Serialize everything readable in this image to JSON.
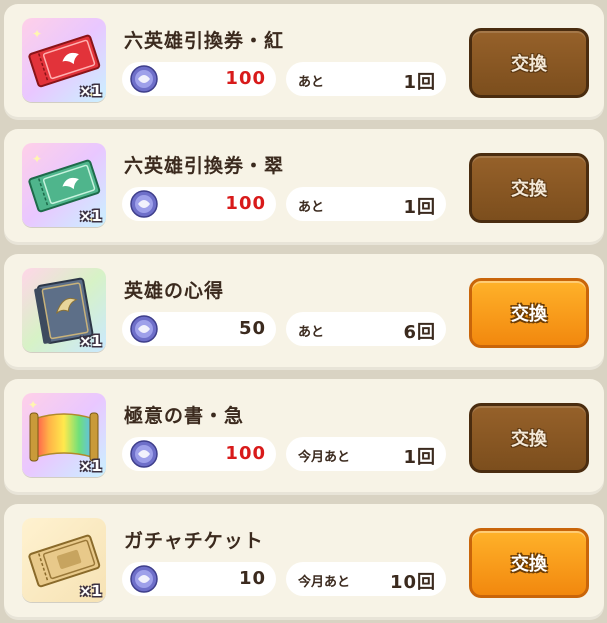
{
  "colors": {
    "price_red": "#d81a1a",
    "price_dark": "#3b2a1e",
    "button_active": "#f59510",
    "button_disabled": "#8a5523",
    "card_bg": "#f7f3e6"
  },
  "items": [
    {
      "name": "六英雄引換券・紅",
      "icon": "red-ticket-icon",
      "quantity": "×1",
      "price": "100",
      "price_color": "#d81a1a",
      "limit_label": "あと",
      "limit_count": "1回",
      "button_label": "交換",
      "button_state": "disabled"
    },
    {
      "name": "六英雄引換券・翠",
      "icon": "green-ticket-icon",
      "quantity": "×1",
      "price": "100",
      "price_color": "#d81a1a",
      "limit_label": "あと",
      "limit_count": "1回",
      "button_label": "交換",
      "button_state": "disabled"
    },
    {
      "name": "英雄の心得",
      "icon": "book-icon",
      "quantity": "×1",
      "price": "50",
      "price_color": "#3b2a1e",
      "limit_label": "あと",
      "limit_count": "6回",
      "button_label": "交換",
      "button_state": "active"
    },
    {
      "name": "極意の書・急",
      "icon": "scroll-icon",
      "quantity": "×1",
      "price": "100",
      "price_color": "#d81a1a",
      "limit_label": "今月あと",
      "limit_count": "1回",
      "button_label": "交換",
      "button_state": "disabled"
    },
    {
      "name": "ガチャチケット",
      "icon": "gacha-ticket-icon",
      "quantity": "×1",
      "price": "10",
      "price_color": "#3b2a1e",
      "limit_label": "今月あと",
      "limit_count": "10回",
      "button_label": "交換",
      "button_state": "active"
    }
  ],
  "currency_icon": "medal-coin-icon"
}
